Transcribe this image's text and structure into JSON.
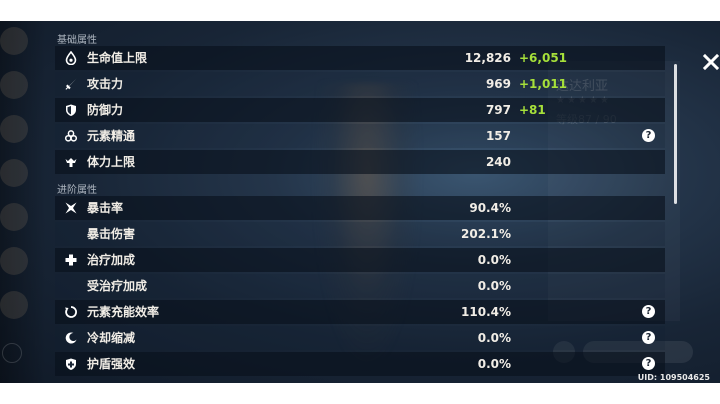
{
  "sections": {
    "basic_label": "基础属性",
    "advanced_label": "进阶属性"
  },
  "basic_stats": [
    {
      "name": "生命值上限",
      "value": "12,826",
      "bonus": "+6,051",
      "icon": "hp-drop-icon"
    },
    {
      "name": "攻击力",
      "value": "969",
      "bonus": "+1,011",
      "icon": "sword-icon"
    },
    {
      "name": "防御力",
      "value": "797",
      "bonus": "+81",
      "icon": "shield-icon"
    },
    {
      "name": "元素精通",
      "value": "157",
      "bonus": "",
      "icon": "elemental-mastery-icon",
      "help": "?"
    },
    {
      "name": "体力上限",
      "value": "240",
      "bonus": "",
      "icon": "stamina-icon"
    }
  ],
  "advanced_stats": [
    {
      "name": "暴击率",
      "value": "90.4%",
      "icon": "crit-icon"
    },
    {
      "name": "暴击伤害",
      "value": "202.1%",
      "icon": ""
    },
    {
      "name": "治疗加成",
      "value": "0.0%",
      "icon": "healing-cross-icon"
    },
    {
      "name": "受治疗加成",
      "value": "0.0%",
      "icon": ""
    },
    {
      "name": "元素充能效率",
      "value": "110.4%",
      "icon": "energy-recharge-icon",
      "help": "?"
    },
    {
      "name": "冷却缩减",
      "value": "0.0%",
      "icon": "cooldown-icon",
      "help": "?"
    },
    {
      "name": "护盾强效",
      "value": "0.0%",
      "icon": "shield-strength-icon",
      "help": "?"
    }
  ],
  "background": {
    "name": "达达利亚",
    "stars": "★★★★★",
    "level": "等级87 / 90"
  },
  "uid": "UID: 109504625",
  "colors": {
    "bonus": "#a6e03a",
    "text": "#f1ede6",
    "section": "#aeb6c0"
  }
}
